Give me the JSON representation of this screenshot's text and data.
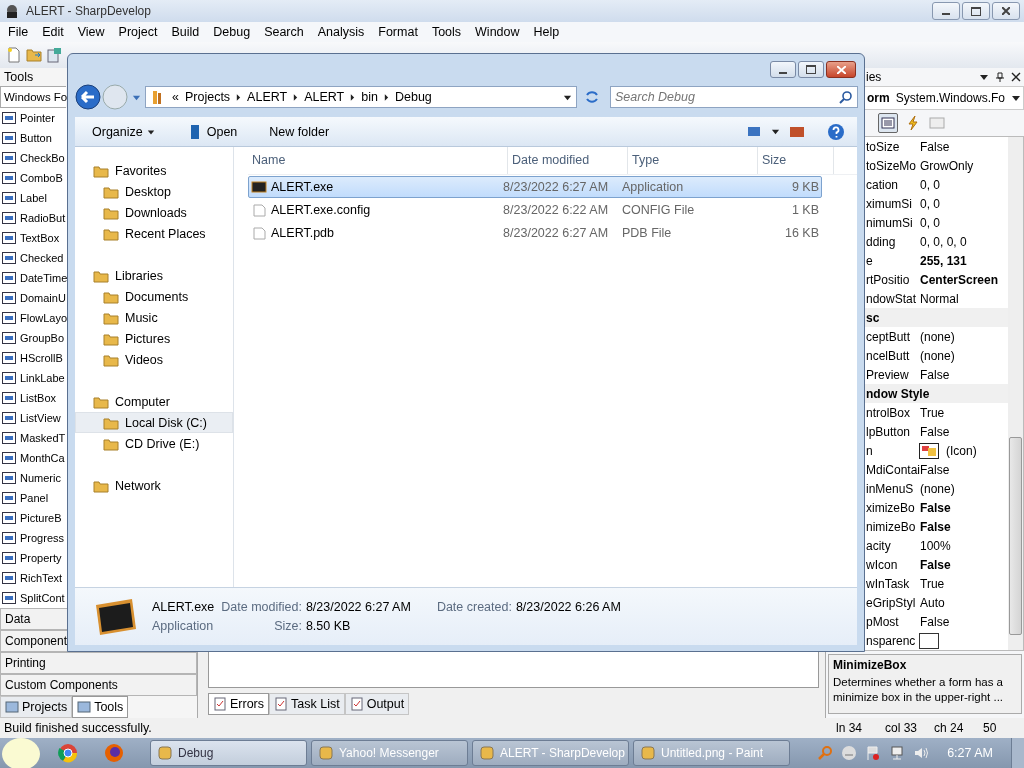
{
  "ide": {
    "title": "ALERT - SharpDevelop",
    "menu": [
      "File",
      "Edit",
      "View",
      "Project",
      "Build",
      "Debug",
      "Search",
      "Analysis",
      "Format",
      "Tools",
      "Window",
      "Help"
    ],
    "tools_panel": {
      "title": "Tools",
      "category": "Windows Fo",
      "items": [
        "Pointer",
        "Button",
        "CheckBo",
        "ComboB",
        "Label",
        "RadioBut",
        "TextBox",
        "Checked",
        "DateTime",
        "DomainU",
        "FlowLayo",
        "GroupBo",
        "HScrollB",
        "LinkLabe",
        "ListBox",
        "ListView",
        "MaskedT",
        "MonthCa",
        "Numeric",
        "Panel",
        "PictureB",
        "Progress",
        "Property",
        "RichText",
        "SplitCont"
      ],
      "categories": [
        "Data",
        "Component",
        "Printing",
        "Custom Components"
      ],
      "tabs": [
        {
          "label": "Projects",
          "selected": false
        },
        {
          "label": "Tools",
          "selected": true
        }
      ]
    },
    "output_tabs": [
      {
        "label": "Errors",
        "selected": true
      },
      {
        "label": "Task List",
        "selected": false
      },
      {
        "label": "Output",
        "selected": false
      }
    ],
    "properties": {
      "title": "ies",
      "object_name": "orm",
      "object_type": "System.Windows.Fo",
      "rows": [
        {
          "kind": "prop",
          "name": "toSize",
          "value": "False",
          "bold": false
        },
        {
          "kind": "prop",
          "name": "toSizeMo",
          "value": "GrowOnly",
          "bold": false
        },
        {
          "kind": "prop",
          "name": "cation",
          "value": "0, 0",
          "bold": false
        },
        {
          "kind": "prop",
          "name": "ximumSi",
          "value": "0, 0",
          "bold": false
        },
        {
          "kind": "prop",
          "name": "nimumSi",
          "value": "0, 0",
          "bold": false
        },
        {
          "kind": "prop",
          "name": "dding",
          "value": "0, 0, 0, 0",
          "bold": false
        },
        {
          "kind": "prop",
          "name": "e",
          "value": "255, 131",
          "bold": true
        },
        {
          "kind": "prop",
          "name": "rtPositio",
          "value": "CenterScreen",
          "bold": true
        },
        {
          "kind": "prop",
          "name": "ndowStat",
          "value": "Normal",
          "bold": false
        },
        {
          "kind": "category",
          "name": "sc"
        },
        {
          "kind": "prop",
          "name": "ceptButt",
          "value": "(none)",
          "bold": false
        },
        {
          "kind": "prop",
          "name": "ncelButt",
          "value": "(none)",
          "bold": false
        },
        {
          "kind": "prop",
          "name": "Preview",
          "value": "False",
          "bold": false
        },
        {
          "kind": "category",
          "name": "ndow Style"
        },
        {
          "kind": "prop",
          "name": "ntrolBox",
          "value": "True",
          "bold": false
        },
        {
          "kind": "prop",
          "name": "lpButton",
          "value": "False",
          "bold": false
        },
        {
          "kind": "image",
          "name": "n",
          "value": "(Icon)"
        },
        {
          "kind": "prop",
          "name": "MdiContai",
          "value": "False",
          "bold": false
        },
        {
          "kind": "prop",
          "name": "inMenuS",
          "value": "(none)",
          "bold": false
        },
        {
          "kind": "prop",
          "name": "ximizeBo",
          "value": "False",
          "bold": true
        },
        {
          "kind": "prop",
          "name": "nimizeBo",
          "value": "False",
          "bold": true
        },
        {
          "kind": "prop",
          "name": "acity",
          "value": "100%",
          "bold": false
        },
        {
          "kind": "prop",
          "name": "wIcon",
          "value": "False",
          "bold": true
        },
        {
          "kind": "prop",
          "name": "wInTask",
          "value": "True",
          "bold": false
        },
        {
          "kind": "prop",
          "name": "eGripStyl",
          "value": "Auto",
          "bold": false
        },
        {
          "kind": "prop",
          "name": "pMost",
          "value": "False",
          "bold": false
        },
        {
          "kind": "swatch",
          "name": "nsparenc"
        }
      ],
      "description": {
        "title": "MinimizeBox",
        "text": "Determines whether a form has a minimize box in the upper-right ..."
      }
    },
    "status": "Build finished successfully.",
    "editor_status": [
      "ln 34",
      "col 33",
      "ch 24",
      "50"
    ]
  },
  "explorer": {
    "overflow_marker": "«",
    "breadcrumb": [
      "Projects",
      "ALERT",
      "ALERT",
      "bin",
      "Debug"
    ],
    "search_placeholder": "Search Debug",
    "commands": [
      "Organize",
      "Open",
      "New folder"
    ],
    "nav": [
      {
        "label": "Favorites",
        "selected": false,
        "children": [
          {
            "label": "Desktop",
            "selected": false
          },
          {
            "label": "Downloads",
            "selected": false
          },
          {
            "label": "Recent Places",
            "selected": false
          }
        ]
      },
      {
        "label": "Libraries",
        "selected": false,
        "children": [
          {
            "label": "Documents",
            "selected": false
          },
          {
            "label": "Music",
            "selected": false
          },
          {
            "label": "Pictures",
            "selected": false
          },
          {
            "label": "Videos",
            "selected": false
          }
        ]
      },
      {
        "label": "Computer",
        "selected": false,
        "children": [
          {
            "label": "Local Disk (C:)",
            "selected": true
          },
          {
            "label": "CD Drive (E:)",
            "selected": false
          }
        ]
      },
      {
        "label": "Network",
        "selected": false
      }
    ],
    "columns": [
      "Name",
      "Date modified",
      "Type",
      "Size"
    ],
    "files": [
      {
        "kind": "app",
        "name": "ALERT.exe",
        "date": "8/23/2022 6:27 AM",
        "type": "Application",
        "size": "9 KB",
        "selected": true
      },
      {
        "kind": "doc",
        "name": "ALERT.exe.config",
        "date": "8/23/2022 6:22 AM",
        "type": "CONFIG File",
        "size": "1 KB",
        "selected": false
      },
      {
        "kind": "doc",
        "name": "ALERT.pdb",
        "date": "8/23/2022 6:27 AM",
        "type": "PDB File",
        "size": "16 KB",
        "selected": false
      }
    ],
    "details": {
      "name": "ALERT.exe",
      "type": "Application",
      "fields": [
        {
          "label": "Date modified:",
          "value": "8/23/2022 6:27 AM"
        },
        {
          "label": "Date created:",
          "value": "8/23/2022 6:26 AM"
        },
        {
          "label": "Size:",
          "value": "8.50 KB"
        }
      ]
    }
  },
  "taskbar": {
    "windows": [
      {
        "label": "Debug",
        "selected": true
      },
      {
        "label": "Yahoo! Messenger",
        "selected": false
      },
      {
        "label": "ALERT - SharpDevelop",
        "selected": false
      },
      {
        "label": "Untitled.png - Paint",
        "selected": false
      }
    ],
    "clock": "6:27 AM"
  }
}
